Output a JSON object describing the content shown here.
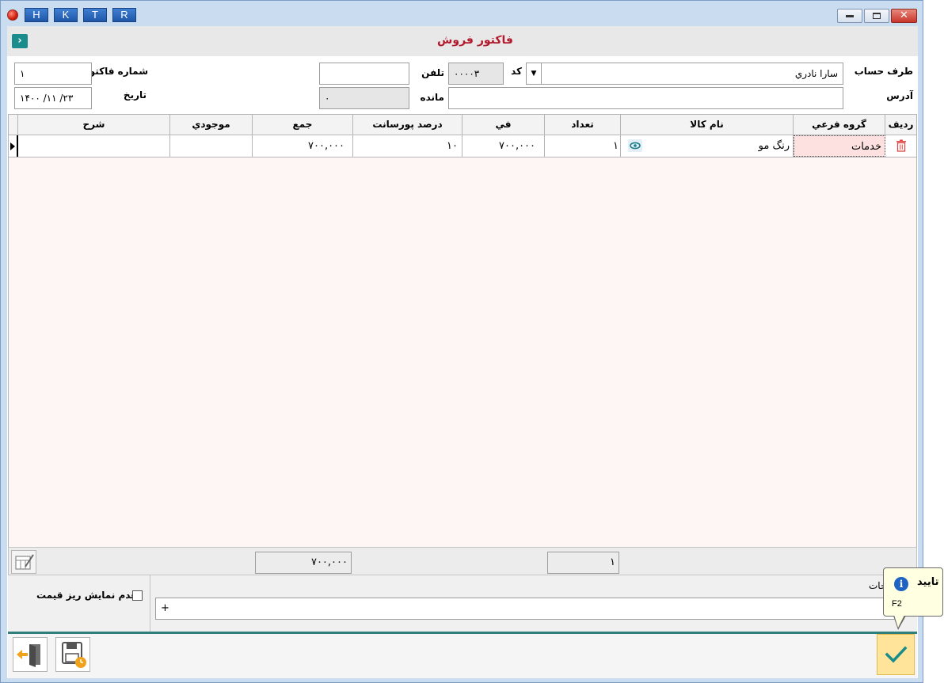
{
  "titlebar": {
    "buttons": [
      "H",
      "K",
      "T",
      "R"
    ],
    "controls": {
      "minimize": "▬",
      "restore": "▣",
      "close": "✕"
    }
  },
  "form": {
    "title": "فاكتور فروش",
    "collapse_icon": "chevron-right"
  },
  "fields": {
    "account_label": "طرف حساب",
    "account_value": "سارا نادري",
    "code_label": "كد",
    "code_value": "۰۰۰۰۳",
    "phone_label": "تلفن",
    "phone_value": "",
    "invoice_no_label": "شماره فاكتور",
    "invoice_no_value": "۱",
    "address_label": "آدرس",
    "address_value": "",
    "balance_label": "مانده",
    "balance_value": "۰",
    "date_label": "تاريخ",
    "date_value": "۱۴۰۰ /۱۱ /۲۳"
  },
  "grid": {
    "columns": [
      "شرح",
      "موجودي",
      "جمع",
      "درصد پورسانت",
      "في",
      "تعداد",
      "نام كالا",
      "گروه فرعي",
      "رديف"
    ],
    "rows": [
      {
        "description": "",
        "stock": "",
        "total": "۷۰۰,۰۰۰",
        "commission_percent": "۱۰",
        "unit_price": "۷۰۰,۰۰۰",
        "quantity": "۱",
        "product_name": "رنگ مو",
        "subgroup": "خدمات"
      }
    ]
  },
  "summary": {
    "total_sum": "۷۰۰,۰۰۰",
    "qty_sum": "۱"
  },
  "options": {
    "hide_price_details_label": "عدم نمايش ريز قيمت",
    "hide_price_details_checked": false
  },
  "description": {
    "label": "حات",
    "value": "+"
  },
  "tooltip": {
    "title": "تاييد",
    "shortcut": "F2"
  },
  "colors": {
    "title_red": "#b1182c",
    "teal": "#1b8c8c",
    "grid_bg": "#fef5f5",
    "confirm_bg": "#ffe49a"
  }
}
